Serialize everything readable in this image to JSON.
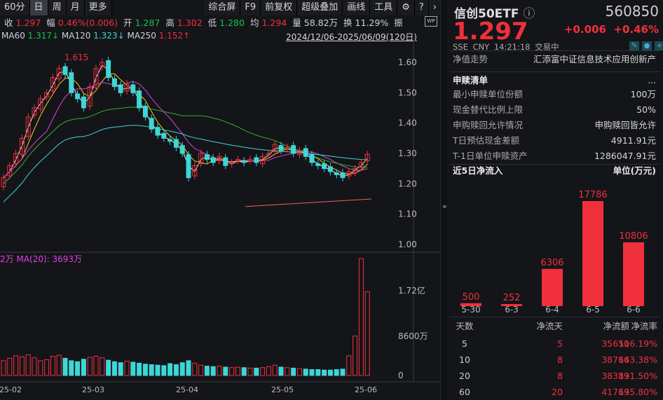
{
  "toolbar": {
    "left": [
      "60分",
      "日",
      "周",
      "月",
      "更多"
    ],
    "right": [
      "综合屏",
      "F9",
      "前复权",
      "超级叠加",
      "画线",
      "工具"
    ],
    "active": "日"
  },
  "quote": {
    "close_l": "收",
    "close": "1.297",
    "amp_l": "幅",
    "amp": "0.46%(0.006)",
    "open_l": "开",
    "open": "1.287",
    "high_l": "高",
    "high": "1.302",
    "low_l": "低",
    "low": "1.280",
    "avg_l": "均",
    "avg": "1.294",
    "vol_l": "量",
    "vol": "58.82万",
    "turn_l": "换",
    "turn": "11.29%",
    "zhen": "振",
    "wp": "WP"
  },
  "ma": {
    "ma60_l": "MA60",
    "ma60": "1.317↓",
    "ma120_l": "MA120",
    "ma120": "1.323↓",
    "ma250_l": "MA250",
    "ma250": "1.152↑"
  },
  "range": "2024/12/06-2025/06/09(120日)",
  "vol_legend": {
    "a": "2万",
    "b": "MA(20): 3693万"
  },
  "peak_label": "1.615",
  "chart_data": {
    "type": "candlestick",
    "y_ticks": [
      "1.60",
      "1.50",
      "1.40",
      "1.30",
      "1.20",
      "1.10",
      "1.00"
    ],
    "ylim": [
      1.0,
      1.6
    ],
    "x_ticks": [
      "25-02",
      "25-03",
      "25-04",
      "25-05",
      "25-06"
    ],
    "closes": [
      1.22,
      1.26,
      1.3,
      1.35,
      1.42,
      1.45,
      1.48,
      1.5,
      1.55,
      1.58,
      1.56,
      1.5,
      1.48,
      1.45,
      1.52,
      1.58,
      1.6,
      1.55,
      1.52,
      1.5,
      1.53,
      1.5,
      1.45,
      1.42,
      1.38,
      1.36,
      1.35,
      1.34,
      1.32,
      1.3,
      1.22,
      1.26,
      1.3,
      1.28,
      1.27,
      1.29,
      1.26,
      1.27,
      1.28,
      1.27,
      1.28,
      1.27,
      1.29,
      1.3,
      1.33,
      1.31,
      1.32,
      1.3,
      1.31,
      1.29,
      1.27,
      1.26,
      1.25,
      1.24,
      1.23,
      1.22,
      1.24,
      1.25,
      1.27,
      1.297
    ],
    "volumes": [
      3000,
      3500,
      4000,
      3800,
      4200,
      3600,
      3000,
      3200,
      3900,
      4100,
      3500,
      3000,
      2800,
      3300,
      3700,
      3900,
      3600,
      3100,
      2800,
      2600,
      2900,
      2700,
      2500,
      2300,
      2200,
      2100,
      2000,
      2400,
      2200,
      2600,
      3000,
      2500,
      2100,
      1900,
      1800,
      1900,
      1700,
      1600,
      1700,
      1600,
      1500,
      1500,
      1600,
      1800,
      2100,
      1700,
      1600,
      1500,
      1400,
      1300,
      1200,
      1200,
      1100,
      1100,
      1200,
      1300,
      4000,
      8000,
      23700,
      17000
    ],
    "vol_ticks": [
      "1.72亿",
      "8600万",
      "0"
    ],
    "vol_ylim": [
      0,
      25000
    ]
  },
  "side": {
    "name": "信创50ETF",
    "code": "560850",
    "price": "1.297",
    "chg": "+0.006",
    "pct": "+0.46%",
    "meta": "SSE  CNY  14:21:18  交易中",
    "nav_l": "净值走势",
    "nav_v": "汇添富中证信息技术应用创新产",
    "list_title": "申赎清单",
    "more": "...",
    "rows": [
      {
        "k": "最小申赎单位份额",
        "v": "100万"
      },
      {
        "k": "现金替代比例上限",
        "v": "50%"
      },
      {
        "k": "申购赎回允许情况",
        "v": "申购赎回皆允许"
      },
      {
        "k": "T日预估现金差额",
        "v": "4911.91元"
      },
      {
        "k": "T-1日单位申赎资产",
        "v": "1286047.91元"
      }
    ],
    "flow_title": "近5日净流入",
    "flow_unit": "单位(万元)",
    "flow": {
      "labels": [
        "5-30",
        "6-3",
        "6-4",
        "6-5",
        "6-6"
      ],
      "values": [
        500,
        252,
        6306,
        17786,
        10806
      ]
    },
    "table": {
      "headers": [
        "天数",
        "净流天",
        "净流额",
        "净流率"
      ],
      "rows": [
        [
          "5",
          "5",
          "35650",
          "116.19%"
        ],
        [
          "10",
          "8",
          "38766",
          "143.38%"
        ],
        [
          "20",
          "8",
          "38389",
          "131.50%"
        ],
        [
          "60",
          "20",
          "41769",
          "135.80%"
        ]
      ]
    }
  },
  "colors": {
    "up": "#f0303c",
    "down": "#3ed6d6",
    "bg": "#141519"
  }
}
